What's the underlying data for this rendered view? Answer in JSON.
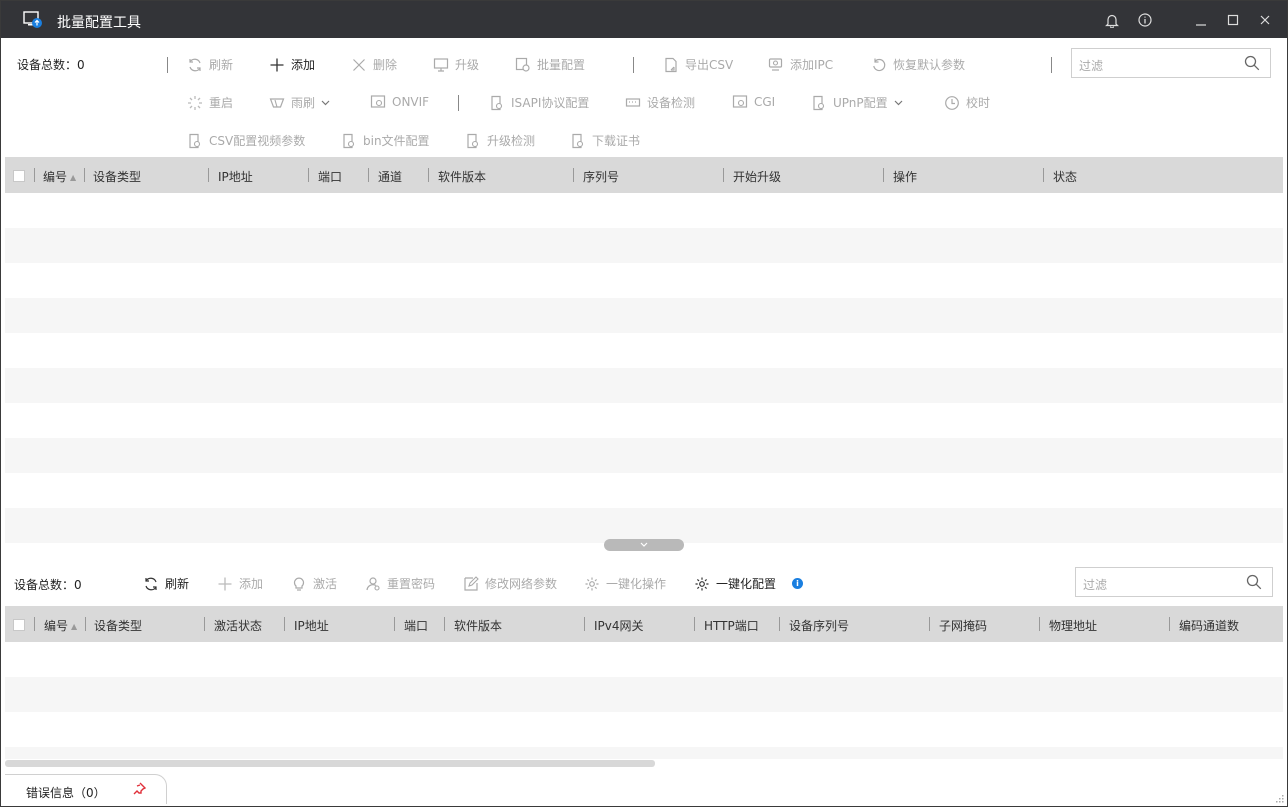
{
  "window": {
    "title": "批量配置工具"
  },
  "top": {
    "count_label": "设备总数：0",
    "buttons_row1": [
      "刷新",
      "添加",
      "删除",
      "升级",
      "批量配置",
      "导出CSV",
      "添加IPC",
      "恢复默认参数"
    ],
    "buttons_row2": [
      "重启",
      "雨刷",
      "ONVIF",
      "ISAPI协议配置",
      "设备检测",
      "CGI",
      "UPnP配置",
      "校时"
    ],
    "buttons_row3": [
      "CSV配置视频参数",
      "bin文件配置",
      "升级检测",
      "下载证书"
    ],
    "filter_placeholder": "过滤",
    "columns": [
      "编号",
      "设备类型",
      "IP地址",
      "端口",
      "通道",
      "软件版本",
      "序列号",
      "开始升级",
      "操作",
      "状态"
    ]
  },
  "bottom": {
    "count_label": "设备总数：0",
    "buttons": [
      "刷新",
      "添加",
      "激活",
      "重置密码",
      "修改网络参数",
      "一键化操作",
      "一键化配置"
    ],
    "filter_placeholder": "过滤",
    "columns": [
      "编号",
      "设备类型",
      "激活状态",
      "IP地址",
      "端口",
      "软件版本",
      "IPv4网关",
      "HTTP端口",
      "设备序列号",
      "子网掩码",
      "物理地址",
      "编码通道数"
    ]
  },
  "error_tab": {
    "label": "错误信息（0）"
  },
  "colors": {
    "titlebar": "#333438",
    "header": "#d9d9d9",
    "accent": "#1a7fe0",
    "pin": "#e0303a"
  }
}
